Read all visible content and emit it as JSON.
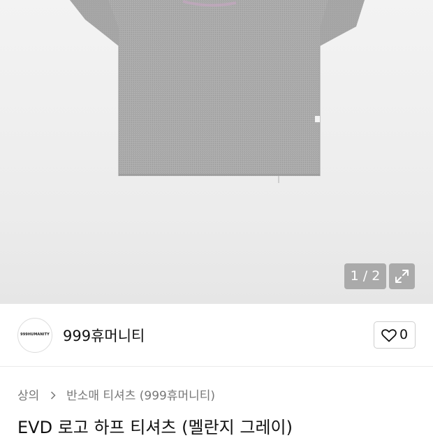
{
  "gallery": {
    "counter": "1 / 2",
    "expand_icon": "expand-icon"
  },
  "brand": {
    "logo_text": "999HUMANITY",
    "name": "999휴머니티",
    "like_icon": "heart-icon",
    "like_count": "0"
  },
  "breadcrumb": {
    "items": [
      "상의",
      "반소매 티셔츠 (999휴머니티)"
    ],
    "separator_icon": "chevron-right-icon"
  },
  "product": {
    "title": "EVD 로고 하프 티셔츠 (멜란지 그레이)"
  }
}
